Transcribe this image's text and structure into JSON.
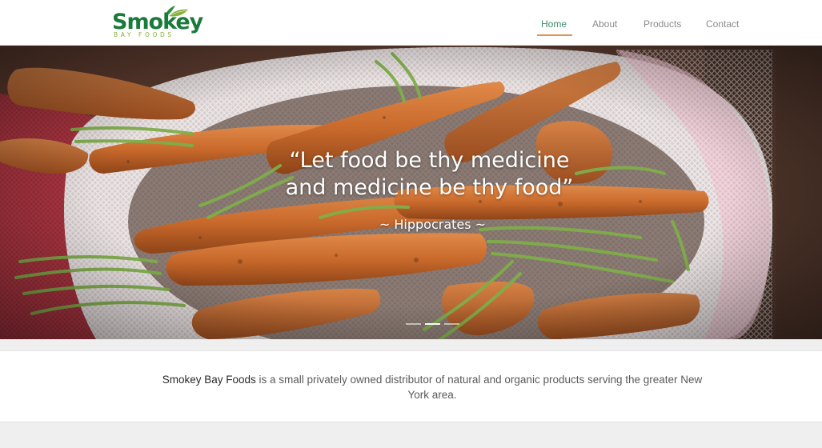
{
  "brand": {
    "logo_word": "Smokey",
    "logo_sub": "BAY FOODS"
  },
  "nav": {
    "items": [
      {
        "label": "Home",
        "active": true
      },
      {
        "label": "About",
        "active": false
      },
      {
        "label": "Products",
        "active": false
      },
      {
        "label": "Contact",
        "active": false
      }
    ]
  },
  "hero": {
    "quote_line1": "“Let food be thy medicine",
    "quote_line2": "and medicine be thy food”",
    "author": "~ Hippocrates ~",
    "slides": 3,
    "active_slide": 2
  },
  "intro": {
    "brand_name": "Smokey Bay Foods",
    "text": " is a small privately owned distributor of natural and organic products serving the greater New York area."
  },
  "colors": {
    "logo_green": "#1a7a3a",
    "logo_lime": "#86b23a",
    "nav_active": "#3c8c6a",
    "nav_underline": "#e09450",
    "nav_inactive": "#8a8a8a"
  }
}
